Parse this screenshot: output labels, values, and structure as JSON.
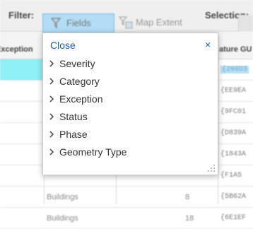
{
  "toolbar": {
    "filter_label": "Filter:",
    "fields_label": "Fields",
    "map_extent_label": "Map Extent",
    "selection_label": "Selection:"
  },
  "table": {
    "columns": [
      "Exception",
      "ature GU"
    ],
    "rows": [
      {
        "category": "",
        "number": "",
        "guid": "{298D3",
        "selected": true
      },
      {
        "category": "",
        "number": "",
        "guid": "{EE9EA",
        "selected": false
      },
      {
        "category": "",
        "number": "",
        "guid": "{9FC01",
        "selected": false
      },
      {
        "category": "",
        "number": "",
        "guid": "{D839A",
        "selected": false
      },
      {
        "category": "",
        "number": "",
        "guid": "{1843A",
        "selected": false
      },
      {
        "category": "",
        "number": "",
        "guid": "{F1A5",
        "selected": false
      },
      {
        "category": "Buildings",
        "number": "8",
        "guid": "{5B62A",
        "selected": false
      },
      {
        "category": "Buildings",
        "number": "18",
        "guid": "{6E1EF",
        "selected": false
      }
    ]
  },
  "popup": {
    "close_label": "Close",
    "close_icon": "×",
    "items": [
      {
        "label": "Severity"
      },
      {
        "label": "Category"
      },
      {
        "label": "Exception"
      },
      {
        "label": "Status"
      },
      {
        "label": "Phase"
      },
      {
        "label": "Geometry Type"
      }
    ]
  },
  "colors": {
    "accent": "#1f5c9c",
    "selected_row": "#8ff0f5",
    "fields_button": "#b3dcf5"
  }
}
